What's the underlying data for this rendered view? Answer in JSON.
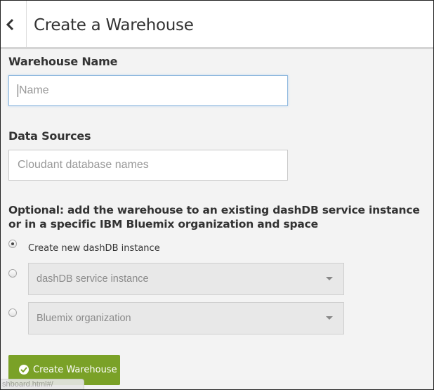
{
  "header": {
    "title": "Create a Warehouse",
    "back_icon": "chevron-left-icon"
  },
  "form": {
    "warehouse_name": {
      "label": "Warehouse Name",
      "placeholder": "Name",
      "value": ""
    },
    "data_sources": {
      "label": "Data Sources",
      "placeholder": "Cloudant database names",
      "value": ""
    },
    "optional_text": "Optional: add the warehouse to an existing dashDB service instance or in a specific IBM Bluemix organization and space",
    "options": [
      {
        "label": "Create new dashDB instance",
        "selected": true
      },
      {
        "placeholder": "dashDB service instance",
        "selected": false
      },
      {
        "placeholder": "Bluemix organization",
        "selected": false
      }
    ],
    "submit_label": "Create Warehouse",
    "submit_icon": "check-circle-icon"
  },
  "status_url": "shboard.html#/",
  "colors": {
    "primary_button": "#7aa127",
    "focus_border": "#8fb8de",
    "background": "#f3f3f3"
  }
}
